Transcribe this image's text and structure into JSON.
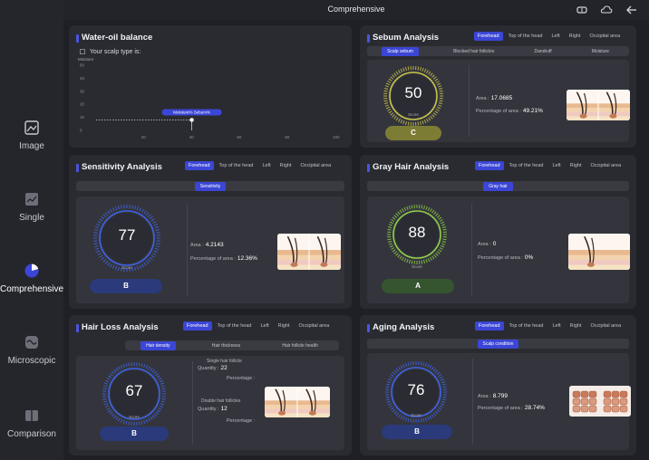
{
  "header": {
    "title": "Comprehensive"
  },
  "sidebar": {
    "items": [
      {
        "label": "Image",
        "icon": "image-icon"
      },
      {
        "label": "Single",
        "icon": "line-chart-icon"
      },
      {
        "label": "Comprehensive",
        "icon": "pie-chart-icon",
        "active": true
      },
      {
        "label": "Microscopic",
        "icon": "microscope-icon"
      },
      {
        "label": "Comparison",
        "icon": "comparison-icon"
      }
    ]
  },
  "regions": [
    "Forehead",
    "Top of the head",
    "Left",
    "Right",
    "Occipital area"
  ],
  "water_oil": {
    "title": "Water-oil balance",
    "scalp_type_label": "Your scalp type is:",
    "chart_data": {
      "type": "scatter",
      "ylabel": "Moisture",
      "y_ticks": [
        "50",
        "40",
        "30",
        "20",
        "10",
        "0"
      ],
      "x_ticks": [
        "20",
        "40",
        "60",
        "80",
        "100"
      ],
      "xlim": [
        0,
        100
      ],
      "ylim": [
        0,
        50
      ],
      "point": {
        "x": 40,
        "y": 8
      },
      "point_label": "Moisture% Sebum%"
    }
  },
  "sebum": {
    "title": "Sebum Analysis",
    "tabs": [
      "Scalp sebum",
      "Blocked hair follicles",
      "Dandruff",
      "Moisture"
    ],
    "score": "50",
    "score_label": "Score",
    "grade": "C",
    "area_label": "Area :",
    "area_value": "17.0685",
    "pct_label": "Percentage of area :",
    "pct_value": "49.21%"
  },
  "sensitivity": {
    "title": "Sensitivity Analysis",
    "tab": "Sensitivity",
    "score": "77",
    "score_label": "Score",
    "grade": "B",
    "area_label": "Area :",
    "area_value": "4.2143",
    "pct_label": "Percentage of area :",
    "pct_value": "12.36%"
  },
  "gray_hair": {
    "title": "Gray Hair Analysis",
    "tab": "Gray hair",
    "score": "88",
    "score_label": "Score",
    "grade": "A",
    "area_label": "Area :",
    "area_value": "0",
    "pct_label": "Percentage of area :",
    "pct_value": "0%"
  },
  "hair_loss": {
    "title": "Hair Loss Analysis",
    "tabs": [
      "Hair density",
      "Hair thickness",
      "Hair follicle health"
    ],
    "score": "67",
    "score_label": "Score",
    "grade": "B",
    "single_title": "Single hair follicle",
    "single_qty_label": "Quantity :",
    "single_qty_value": "22",
    "single_pct_label": "Percentage :",
    "double_title": "Double hair follicles",
    "double_qty_label": "Quantity :",
    "double_qty_value": "12",
    "double_pct_label": "Percentage :"
  },
  "aging": {
    "title": "Aging Analysis",
    "tab": "Scalp condition",
    "score": "76",
    "score_label": "Score",
    "grade": "B",
    "area_label": "Area :",
    "area_value": "8.799",
    "pct_label": "Percentage of area :",
    "pct_value": "28.74%"
  },
  "colors": {
    "accent": "#3b46d6",
    "gauge_blue": "#3e63e8",
    "gauge_yellow": "#c9c44a",
    "gauge_green": "#8fd04a",
    "grade_c": "#8a8a3a",
    "grade_a": "#3f6b3a",
    "grade_b": "#2c3f82"
  }
}
